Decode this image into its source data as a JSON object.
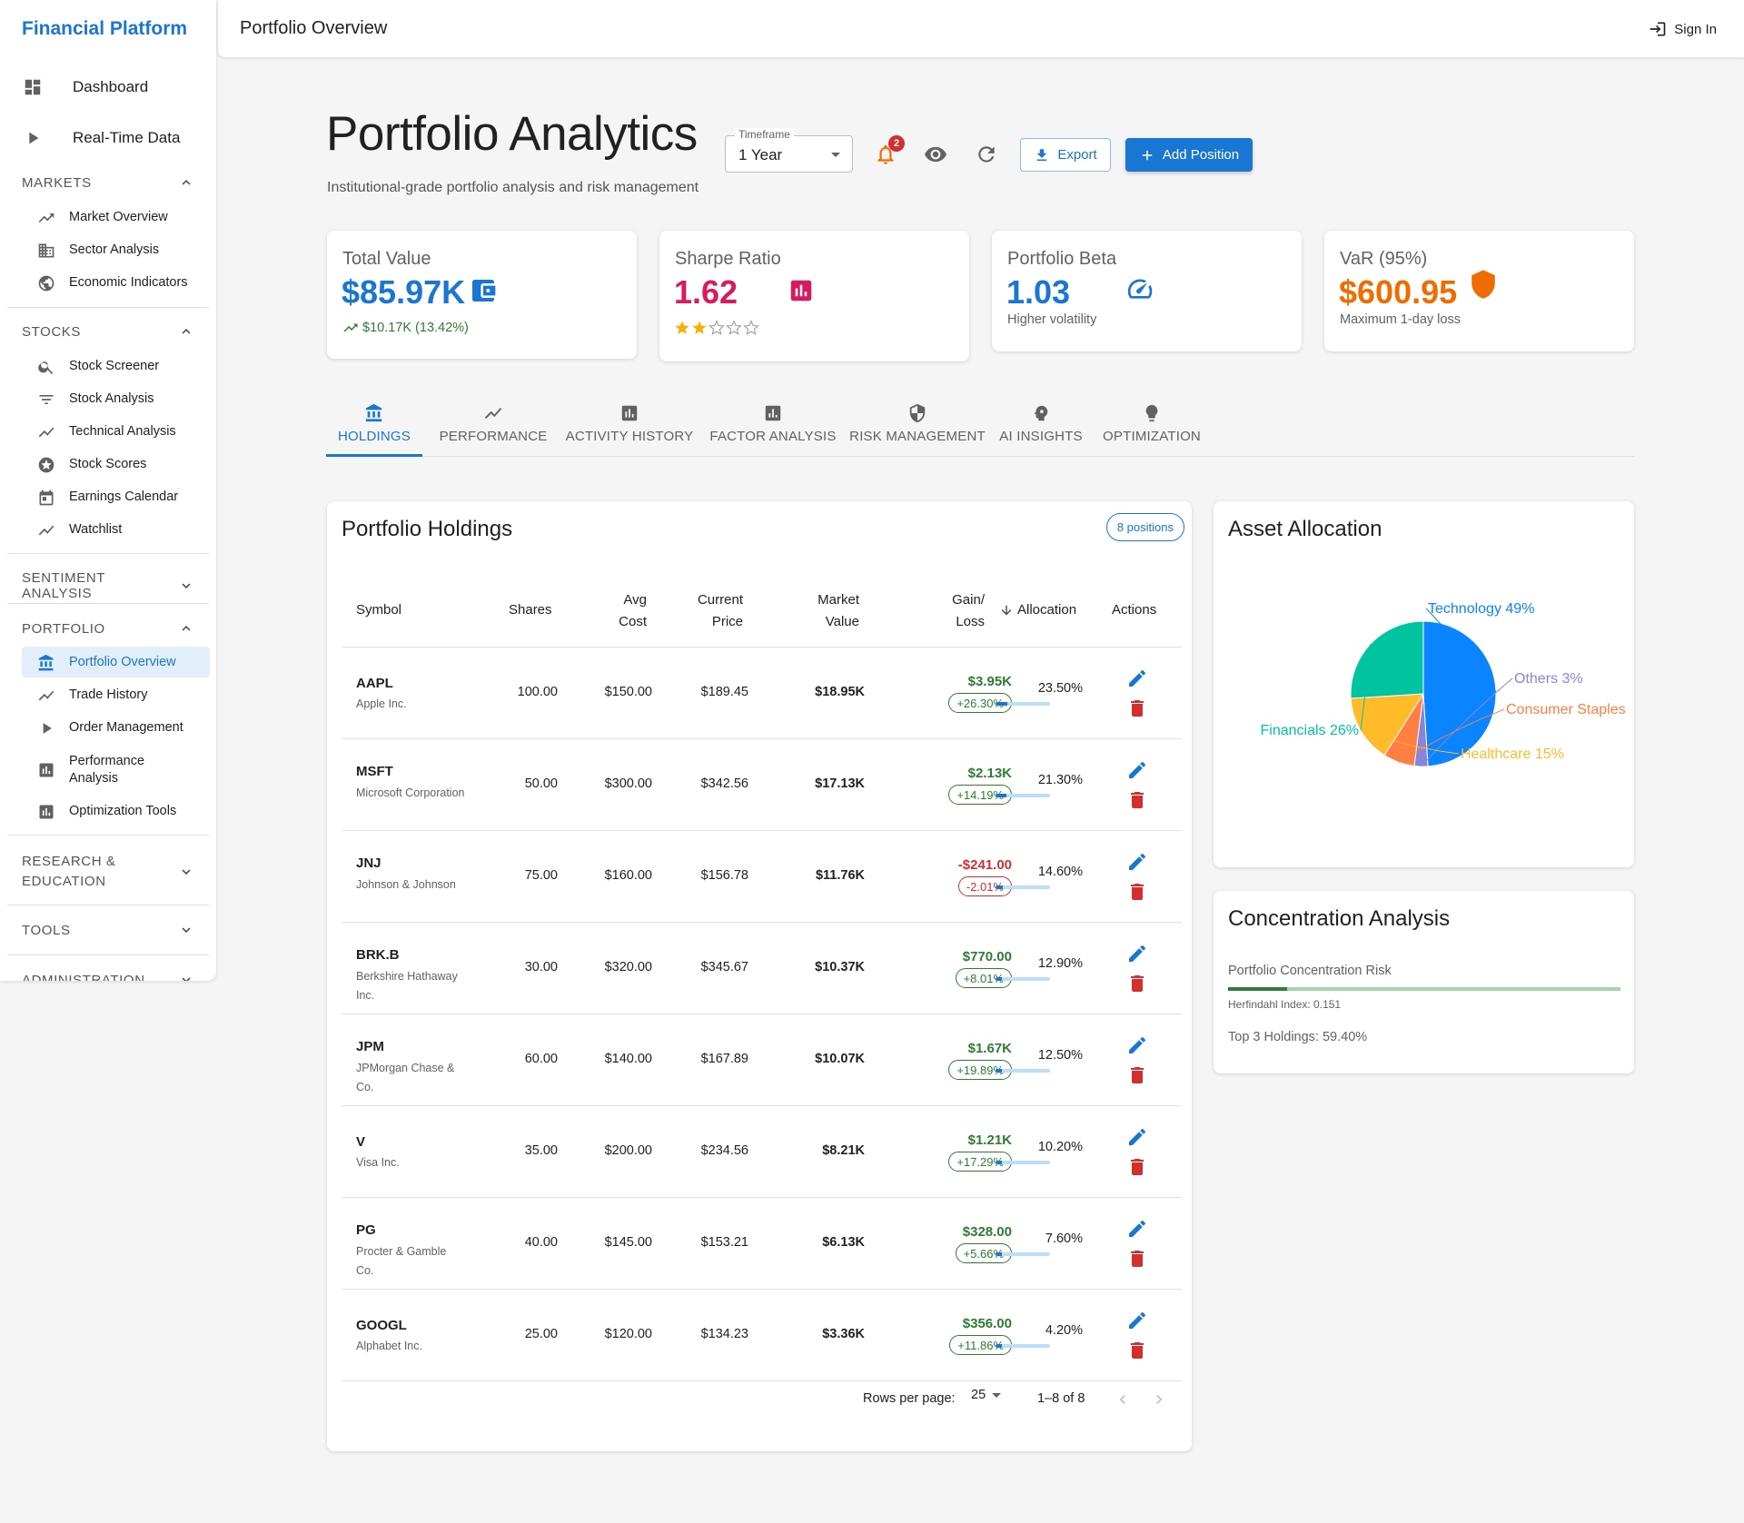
{
  "app": {
    "brand": "Financial Platform",
    "page_title": "Portfolio Overview",
    "sign_in": "Sign In"
  },
  "sidebar": {
    "top_items": [
      {
        "label": "Dashboard",
        "icon": "dashboard-icon"
      },
      {
        "label": "Real-Time Data",
        "icon": "play-icon"
      }
    ],
    "sections": {
      "markets": {
        "title": "MARKETS",
        "items": [
          "Market Overview",
          "Sector Analysis",
          "Economic Indicators"
        ]
      },
      "stocks": {
        "title": "STOCKS",
        "items": [
          "Stock Screener",
          "Stock Analysis",
          "Technical Analysis",
          "Stock Scores",
          "Earnings Calendar",
          "Watchlist"
        ]
      },
      "sentiment": {
        "title": "SENTIMENT ANALYSIS"
      },
      "portfolio": {
        "title": "PORTFOLIO",
        "items": [
          "Portfolio Overview",
          "Trade History",
          "Order Management",
          "Performance Analysis",
          "Optimization Tools"
        ],
        "active": "Portfolio Overview"
      },
      "research": {
        "title": "RESEARCH & EDUCATION"
      },
      "tools": {
        "title": "TOOLS"
      },
      "admin": {
        "title": "ADMINISTRATION"
      }
    }
  },
  "header": {
    "title": "Portfolio Analytics",
    "subtitle": "Institutional-grade portfolio analysis and risk management",
    "timeframe": {
      "label": "Timeframe",
      "value": "1 Year"
    },
    "notification_count": "2",
    "export_label": "Export",
    "add_label": "Add Position"
  },
  "kpis": {
    "total_value": {
      "label": "Total Value",
      "value": "$85.97K",
      "change": "$10.17K (13.42%)",
      "color": "#1976d2"
    },
    "sharpe": {
      "label": "Sharpe Ratio",
      "value": "1.62",
      "rating": 2,
      "rating_max": 5,
      "color": "#d81b60"
    },
    "beta": {
      "label": "Portfolio Beta",
      "value": "1.03",
      "note": "Higher volatility",
      "color": "#1976d2"
    },
    "var": {
      "label": "VaR (95%)",
      "value": "$600.95",
      "note": "Maximum 1-day loss",
      "color": "#ef6c00"
    }
  },
  "tabs": [
    {
      "label": "HOLDINGS",
      "icon": "bank-icon",
      "active": true
    },
    {
      "label": "PERFORMANCE",
      "icon": "trending-up-icon"
    },
    {
      "label": "ACTIVITY HISTORY",
      "icon": "bar-chart-icon"
    },
    {
      "label": "FACTOR ANALYSIS",
      "icon": "chart-box-icon"
    },
    {
      "label": "RISK MANAGEMENT",
      "icon": "shield-icon"
    },
    {
      "label": "AI INSIGHTS",
      "icon": "brain-icon"
    },
    {
      "label": "OPTIMIZATION",
      "icon": "lightbulb-icon"
    }
  ],
  "holdings": {
    "title": "Portfolio Holdings",
    "count_label": "8 positions",
    "columns": {
      "symbol": "Symbol",
      "shares": "Shares",
      "avg_cost_1": "Avg",
      "avg_cost_2": "Cost",
      "price_1": "Current",
      "price_2": "Price",
      "mv_1": "Market",
      "mv_2": "Value",
      "gain_1": "Gain/",
      "gain_2": "Loss",
      "allocation": "Allocation",
      "actions": "Actions"
    },
    "rows": [
      {
        "symbol": "AAPL",
        "name": "Apple Inc.",
        "shares": "100.00",
        "avg_cost": "$150.00",
        "price": "$189.45",
        "market_value": "$18.95K",
        "gain": "$3.95K",
        "gain_pct": "+26.30%",
        "positive": true,
        "allocation": "23.50%",
        "alloc_frac": 0.235
      },
      {
        "symbol": "MSFT",
        "name": "Microsoft Corporation",
        "shares": "50.00",
        "avg_cost": "$300.00",
        "price": "$342.56",
        "market_value": "$17.13K",
        "gain": "$2.13K",
        "gain_pct": "+14.19%",
        "positive": true,
        "allocation": "21.30%",
        "alloc_frac": 0.213
      },
      {
        "symbol": "JNJ",
        "name": "Johnson & Johnson",
        "shares": "75.00",
        "avg_cost": "$160.00",
        "price": "$156.78",
        "market_value": "$11.76K",
        "gain": "-$241.00",
        "gain_pct": "-2.01%",
        "positive": false,
        "allocation": "14.60%",
        "alloc_frac": 0.146
      },
      {
        "symbol": "BRK.B",
        "name": "Berkshire Hathaway Inc.",
        "shares": "30.00",
        "avg_cost": "$320.00",
        "price": "$345.67",
        "market_value": "$10.37K",
        "gain": "$770.00",
        "gain_pct": "+8.01%",
        "positive": true,
        "allocation": "12.90%",
        "alloc_frac": 0.129
      },
      {
        "symbol": "JPM",
        "name": "JPMorgan Chase & Co.",
        "shares": "60.00",
        "avg_cost": "$140.00",
        "price": "$167.89",
        "market_value": "$10.07K",
        "gain": "$1.67K",
        "gain_pct": "+19.89%",
        "positive": true,
        "allocation": "12.50%",
        "alloc_frac": 0.125
      },
      {
        "symbol": "V",
        "name": "Visa Inc.",
        "shares": "35.00",
        "avg_cost": "$200.00",
        "price": "$234.56",
        "market_value": "$8.21K",
        "gain": "$1.21K",
        "gain_pct": "+17.29%",
        "positive": true,
        "allocation": "10.20%",
        "alloc_frac": 0.102
      },
      {
        "symbol": "PG",
        "name": "Procter & Gamble Co.",
        "shares": "40.00",
        "avg_cost": "$145.00",
        "price": "$153.21",
        "market_value": "$6.13K",
        "gain": "$328.00",
        "gain_pct": "+5.66%",
        "positive": true,
        "allocation": "7.60%",
        "alloc_frac": 0.076
      },
      {
        "symbol": "GOOGL",
        "name": "Alphabet Inc.",
        "shares": "25.00",
        "avg_cost": "$120.00",
        "price": "$134.23",
        "market_value": "$3.36K",
        "gain": "$356.00",
        "gain_pct": "+11.86%",
        "positive": true,
        "allocation": "4.20%",
        "alloc_frac": 0.042
      }
    ],
    "pagination": {
      "rows_per_page_label": "Rows per page:",
      "rows_per_page": "25",
      "range": "1–8 of 8"
    }
  },
  "allocation": {
    "title": "Asset Allocation",
    "chart_data": {
      "type": "pie",
      "slices": [
        {
          "label": "Technology 49%",
          "value": 49,
          "color": "#0a84ff"
        },
        {
          "label": "Others 3%",
          "value": 3,
          "color": "#8884d8"
        },
        {
          "label": "Consumer Staples",
          "value": 7,
          "color": "#ff7f43"
        },
        {
          "label": "Healthcare 15%",
          "value": 15,
          "color": "#ffbb28"
        },
        {
          "label": "Financials 26%",
          "value": 26,
          "color": "#00c49f"
        }
      ]
    }
  },
  "concentration": {
    "title": "Concentration Analysis",
    "risk_label": "Portfolio Concentration Risk",
    "risk_level": 0.151,
    "hhi": "Herfindahl Index: 0.151",
    "top3": "Top 3 Holdings: 59.40%"
  }
}
